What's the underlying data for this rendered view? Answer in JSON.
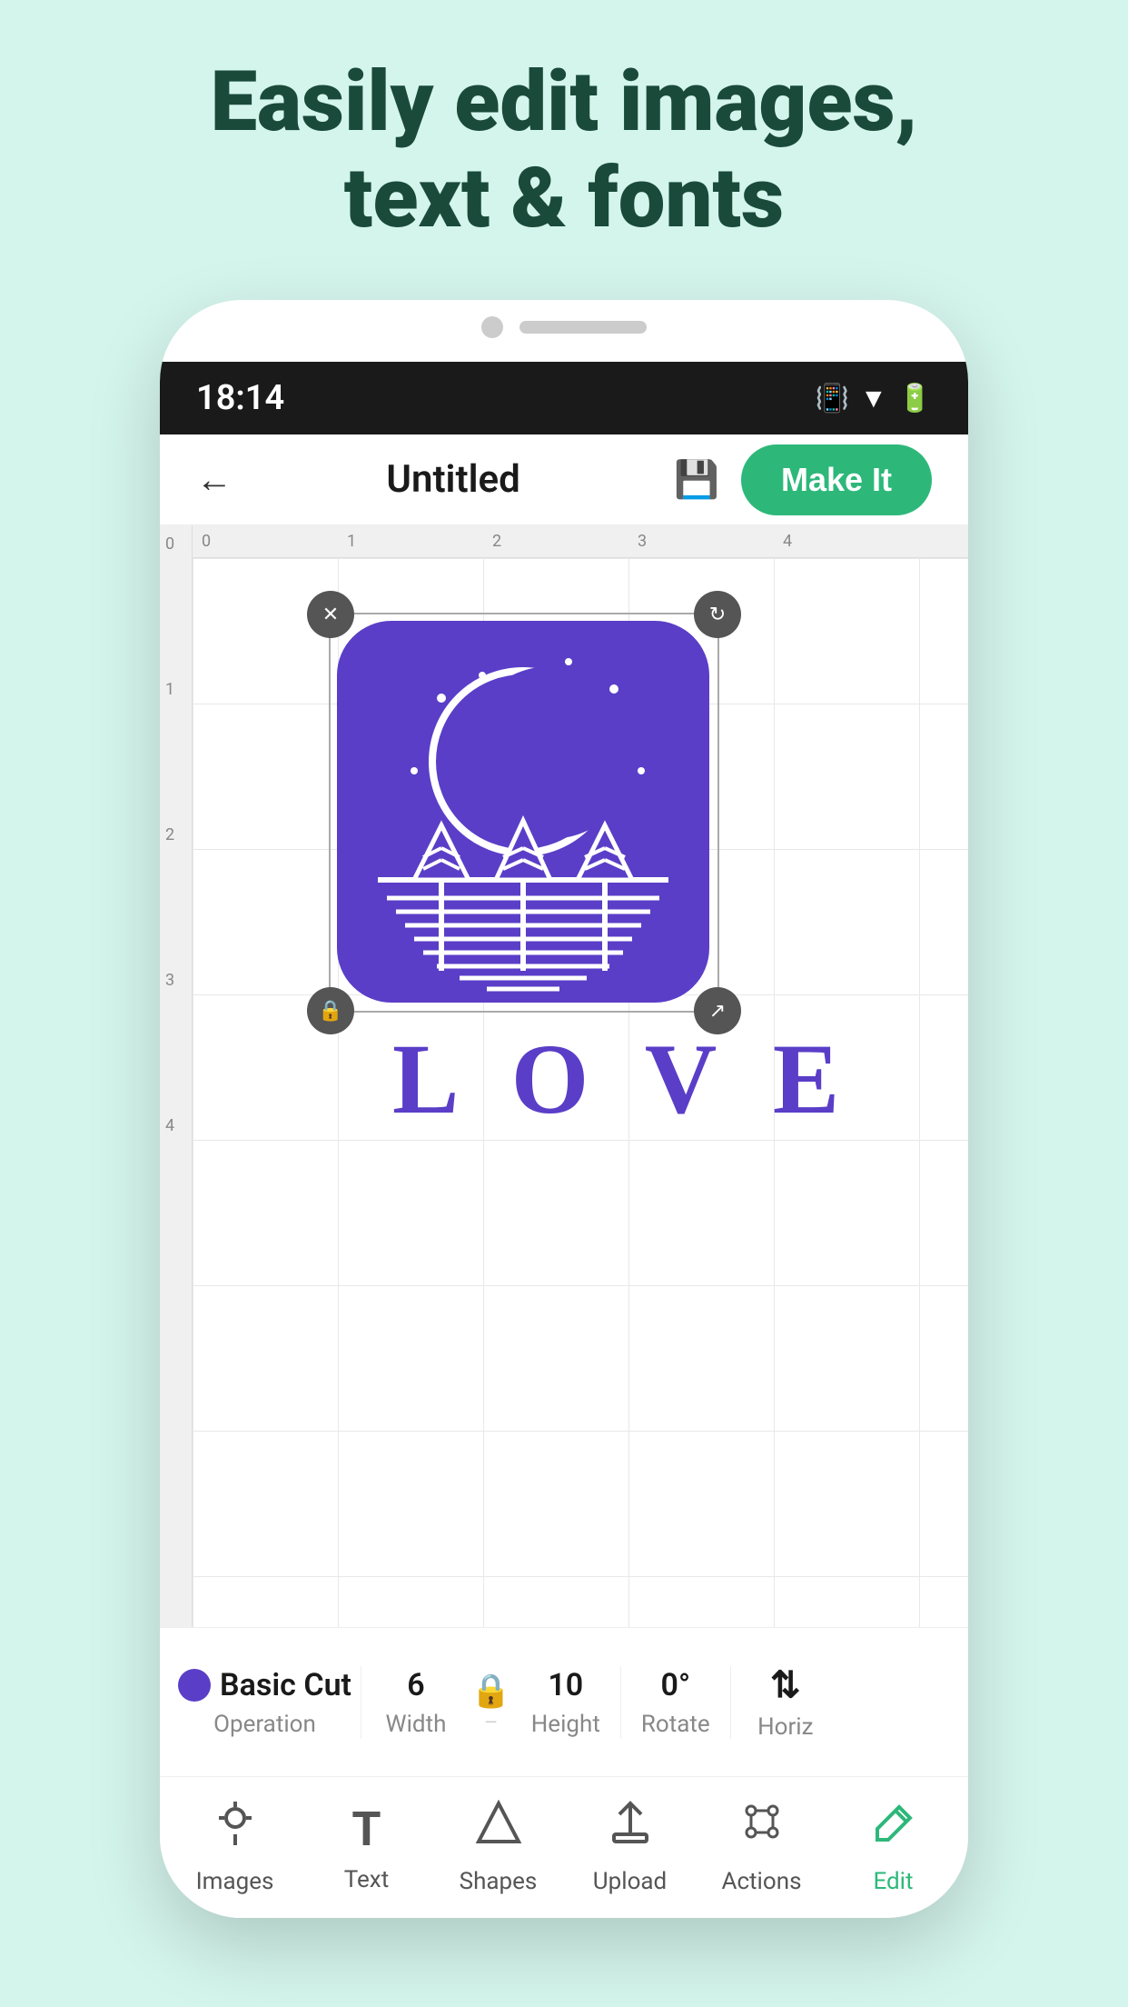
{
  "header": {
    "line1": "Easily edit images,",
    "line2": "text & fonts"
  },
  "statusBar": {
    "time": "18:14",
    "icons": [
      "vibrate",
      "wifi",
      "battery"
    ]
  },
  "appBar": {
    "back_label": "←",
    "title": "Untitled",
    "makeIt_label": "Make It"
  },
  "canvas": {
    "artwork_text": "LOVE"
  },
  "propertiesBar": {
    "operation_label": "Operation",
    "operation_value": "Basic Cut",
    "width_label": "Width",
    "width_value": "6",
    "height_label": "Height",
    "height_value": "10",
    "rotate_label": "Rotate",
    "rotate_value": "0°",
    "horiz_label": "Horiz",
    "horiz_value": "↕"
  },
  "bottomNav": {
    "items": [
      {
        "id": "images",
        "label": "Images",
        "icon": "💡",
        "active": false
      },
      {
        "id": "text",
        "label": "Text",
        "icon": "T",
        "active": false
      },
      {
        "id": "shapes",
        "label": "Shapes",
        "icon": "△",
        "active": false
      },
      {
        "id": "upload",
        "label": "Upload",
        "icon": "↑",
        "active": false
      },
      {
        "id": "actions",
        "label": "Actions",
        "icon": "⬡",
        "active": false
      },
      {
        "id": "edit",
        "label": "Edit",
        "icon": "✏",
        "active": true
      }
    ]
  }
}
